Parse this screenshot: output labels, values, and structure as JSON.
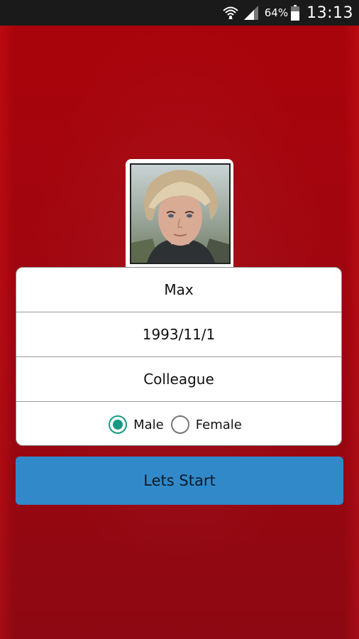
{
  "status_bar": {
    "battery": "64%",
    "time": "13:13",
    "icons": [
      "wifi-icon",
      "signal-icon",
      "battery-icon"
    ]
  },
  "profile": {
    "photo": "person-photo"
  },
  "form": {
    "name": "Max",
    "birthdate": "1993/11/1",
    "relation": "Colleague",
    "gender": {
      "options": [
        "Male",
        "Female"
      ],
      "selected": "Male"
    }
  },
  "actions": {
    "start_label": "Lets Start"
  },
  "colors": {
    "background": "#a1050e",
    "button": "#3189c9",
    "radio_accent": "#159a82"
  }
}
